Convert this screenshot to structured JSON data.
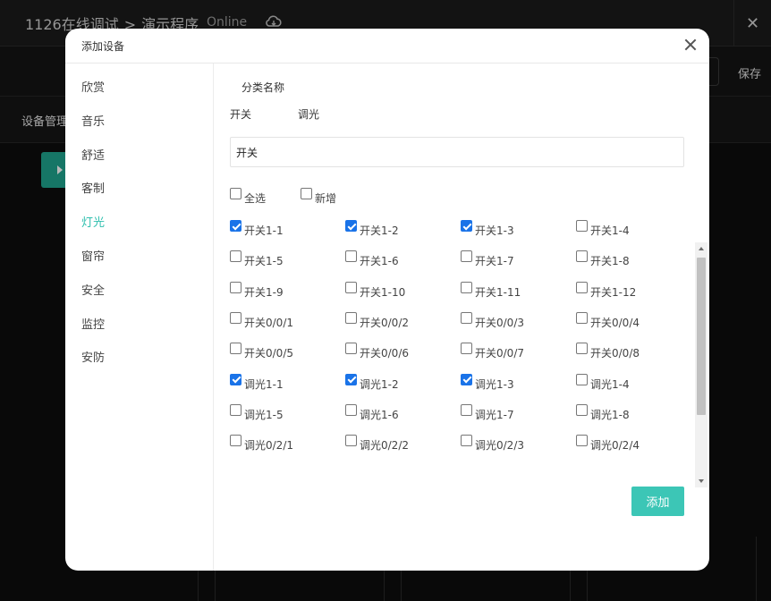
{
  "app": {
    "project": "1126在线调试",
    "separator": ">",
    "program": "演示程序",
    "status": "Online",
    "close_glyph": "✕",
    "save_label": "保存",
    "device_mgmt": "设备管理"
  },
  "modal": {
    "title": "添加设备",
    "sidebar": [
      "欣赏",
      "音乐",
      "舒适",
      "客制",
      "灯光",
      "窗帘",
      "安全",
      "监控",
      "安防"
    ],
    "active_index": 4,
    "category_header": "分类名称",
    "category_tabs": [
      "开关",
      "调光"
    ],
    "name_value": "开关",
    "select_all": {
      "label": "全选",
      "checked": false
    },
    "add_new": {
      "label": "新增",
      "checked": false
    },
    "devices": [
      {
        "label": "开关1-1",
        "checked": true
      },
      {
        "label": "开关1-2",
        "checked": true
      },
      {
        "label": "开关1-3",
        "checked": true
      },
      {
        "label": "开关1-4",
        "checked": false
      },
      {
        "label": "开关1-5",
        "checked": false
      },
      {
        "label": "开关1-6",
        "checked": false
      },
      {
        "label": "开关1-7",
        "checked": false
      },
      {
        "label": "开关1-8",
        "checked": false
      },
      {
        "label": "开关1-9",
        "checked": false
      },
      {
        "label": "开关1-10",
        "checked": false
      },
      {
        "label": "开关1-11",
        "checked": false
      },
      {
        "label": "开关1-12",
        "checked": false
      },
      {
        "label": "开关0/0/1",
        "checked": false
      },
      {
        "label": "开关0/0/2",
        "checked": false
      },
      {
        "label": "开关0/0/3",
        "checked": false
      },
      {
        "label": "开关0/0/4",
        "checked": false
      },
      {
        "label": "开关0/0/5",
        "checked": false
      },
      {
        "label": "开关0/0/6",
        "checked": false
      },
      {
        "label": "开关0/0/7",
        "checked": false
      },
      {
        "label": "开关0/0/8",
        "checked": false
      },
      {
        "label": "调光1-1",
        "checked": true
      },
      {
        "label": "调光1-2",
        "checked": true
      },
      {
        "label": "调光1-3",
        "checked": true
      },
      {
        "label": "调光1-4",
        "checked": false
      },
      {
        "label": "调光1-5",
        "checked": false
      },
      {
        "label": "调光1-6",
        "checked": false
      },
      {
        "label": "调光1-7",
        "checked": false
      },
      {
        "label": "调光1-8",
        "checked": false
      },
      {
        "label": "调光0/2/1",
        "checked": false
      },
      {
        "label": "调光0/2/2",
        "checked": false
      },
      {
        "label": "调光0/2/3",
        "checked": false
      },
      {
        "label": "调光0/2/4",
        "checked": false
      }
    ],
    "add_button": "添加"
  },
  "colors": {
    "accent": "#2fbfae",
    "add_button": "#3cc6b6",
    "checkbox_checked": "#1a73e8",
    "play_button": "#1fa48e"
  }
}
